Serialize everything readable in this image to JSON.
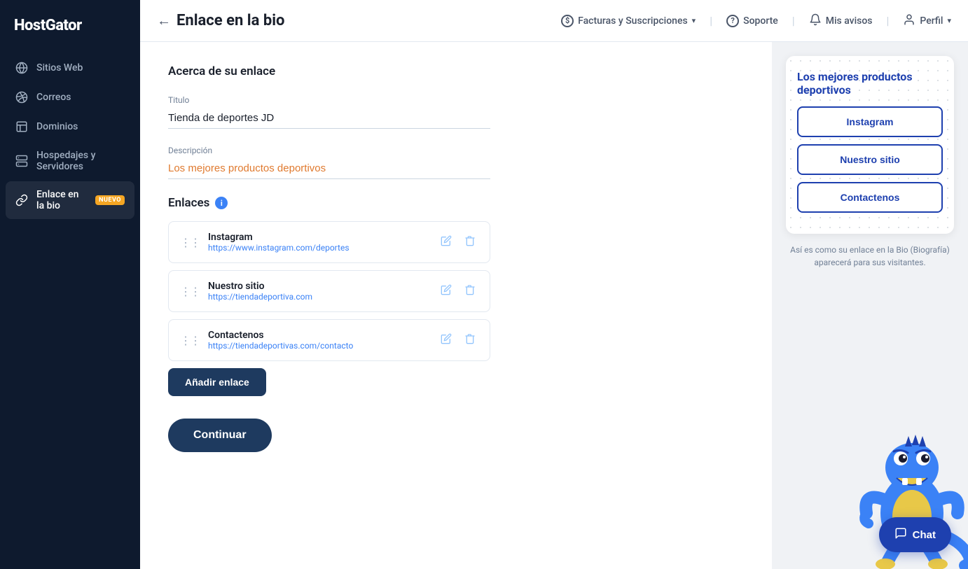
{
  "brand": {
    "name": "HostGator"
  },
  "sidebar": {
    "items": [
      {
        "id": "sitios-web",
        "label": "Sitios Web",
        "icon": "globe"
      },
      {
        "id": "correos",
        "label": "Correos",
        "icon": "mail"
      },
      {
        "id": "dominios",
        "label": "Dominios",
        "icon": "file"
      },
      {
        "id": "hospedajes",
        "label": "Hospedajes y Servidores",
        "icon": "server"
      },
      {
        "id": "enlace-bio",
        "label": "Enlace en la bio",
        "icon": "link",
        "active": true,
        "badge": "NUEVO"
      }
    ]
  },
  "topnav": {
    "back_label": "Enlace en la bio",
    "billing_label": "Facturas y Suscripciones",
    "support_label": "Soporte",
    "notices_label": "Mis avisos",
    "profile_label": "Perfil"
  },
  "form": {
    "section_title": "Acerca de su enlace",
    "title_label": "Titulo",
    "title_value": "Tienda de deportes JD",
    "description_label": "Descripción",
    "description_value": "Los mejores productos deportivos",
    "links_title": "Enlaces",
    "links": [
      {
        "name": "Instagram",
        "url": "https://www.instagram.com/deportes"
      },
      {
        "name": "Nuestro sitio",
        "url": "https://tiendadeportiva.com"
      },
      {
        "name": "Contactenos",
        "url": "https://tiendadeportivas.com/contacto"
      }
    ],
    "add_link_label": "Añadir enlace",
    "continue_label": "Continuar"
  },
  "preview": {
    "title": "Los mejores productos deportivos",
    "buttons": [
      {
        "label": "Instagram"
      },
      {
        "label": "Nuestro sitio"
      },
      {
        "label": "Contactenos"
      }
    ],
    "caption": "Así es como su enlace en la Bio (Biografía) aparecerá para sus visitantes."
  },
  "chat": {
    "label": "Chat"
  }
}
